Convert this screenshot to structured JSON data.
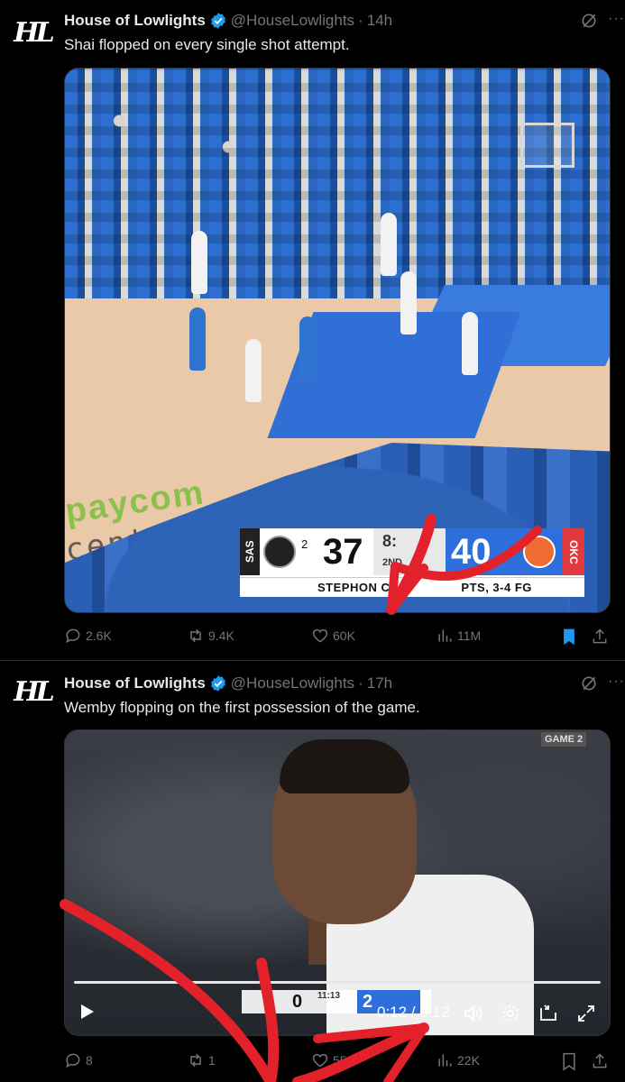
{
  "tweets": [
    {
      "avatar_text": "HL",
      "name": "House of Lowlights",
      "handle": "@HouseLowlights",
      "time": "14h",
      "text": "Shai flopped on every single shot attempt.",
      "media": {
        "court_text_1": "paycom",
        "court_text_2": "center",
        "scorebug": {
          "away_team": "SAS",
          "away_fouls": "2",
          "away_score": "37",
          "clock": "8:",
          "period": "2ND",
          "home_score": "40",
          "home_team": "OKC",
          "ticker": "STEPHON CAS",
          "ticker_tail": "PTS, 3-4 FG"
        }
      },
      "stats": {
        "replies": "2.6K",
        "reposts": "9.4K",
        "likes": "60K",
        "views": "11M"
      }
    },
    {
      "avatar_text": "HL",
      "name": "House of Lowlights",
      "handle": "@HouseLowlights",
      "time": "17h",
      "text": "Wemby flopping on the first possession of the game.",
      "media": {
        "game_badge": "GAME 2",
        "away_score": "0",
        "clock": "11:13",
        "home_score": "2",
        "video_time": "0:12 / 0:12",
        "progress_fraction": 1.0
      },
      "stats": {
        "replies": "8",
        "reposts": "1",
        "likes": "55",
        "views": "22K"
      }
    }
  ],
  "colors": {
    "background": "#000000",
    "muted": "#71767b",
    "text": "#e7e9ea",
    "verified": "#1d9bf0",
    "bookmark_active": "#1d9bf0",
    "annotation": "#e3212b"
  },
  "icons": {
    "verified": "verified-badge-icon",
    "grok": "grok-icon",
    "more": "more-icon",
    "reply": "reply-icon",
    "repost": "repost-icon",
    "like": "like-icon",
    "views": "views-icon",
    "bookmark": "bookmark-icon",
    "share": "share-icon"
  }
}
